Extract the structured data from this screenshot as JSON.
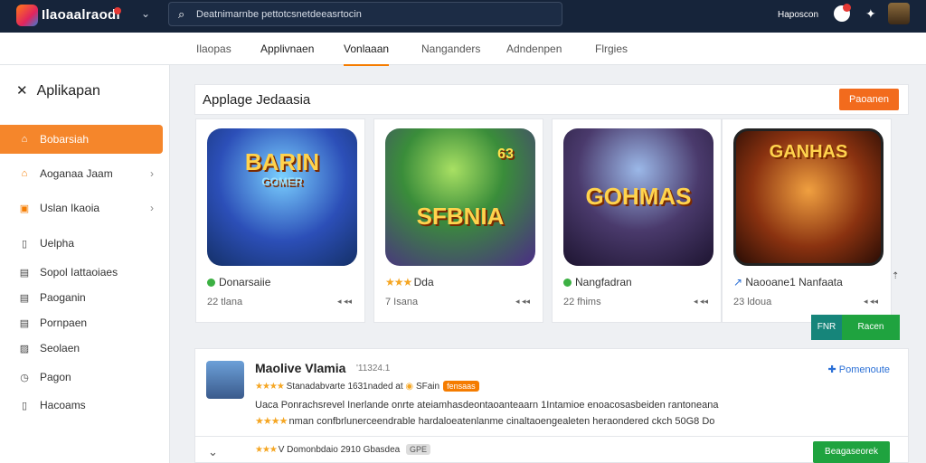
{
  "header": {
    "app_name": "Ilaoaalraodi",
    "search_placeholder": "Deatnimarnbe pettotcsnetdeeasrtocin",
    "user_name": "Haposcon"
  },
  "tabs": [
    {
      "label": "Ilaopas"
    },
    {
      "label": "Applivnaen"
    },
    {
      "label": "Vonlaaan"
    },
    {
      "label": "Nanganders"
    },
    {
      "label": "Adndenpen"
    },
    {
      "label": "Flrgies"
    }
  ],
  "sidebar": {
    "title": "Aplikapan",
    "items": [
      {
        "label": "Bobarsiah",
        "icon": "home-icon"
      },
      {
        "label": "Aoganaa Jaam",
        "icon": "folder-icon"
      },
      {
        "label": "Uslan Ikaoia",
        "icon": "apps-icon"
      },
      {
        "label": "Uelpha",
        "icon": "doc-icon"
      },
      {
        "label": "Sopol Iattaoiaes",
        "icon": "doc-icon"
      },
      {
        "label": "Paoganin",
        "icon": "doc-icon"
      },
      {
        "label": "Pornpaen",
        "icon": "doc-icon"
      },
      {
        "label": "Seolaen",
        "icon": "image-icon"
      },
      {
        "label": "Pagon",
        "icon": "clock-icon"
      },
      {
        "label": "Hacoams",
        "icon": "doc-icon"
      }
    ]
  },
  "section": {
    "title": "Applage Jedaasia",
    "button_label": "Paoanen"
  },
  "games": [
    {
      "art_title": "BARIN",
      "art_sub": "GOMER",
      "name": "Donarsaiie",
      "meta": "22 tlana",
      "status_color": "#3cb043"
    },
    {
      "art_title": "SFBNIA",
      "art_sub": "63",
      "name": "Dda",
      "meta": "7 Isana",
      "status_color": "#f5a623"
    },
    {
      "art_title": "GOHMAS",
      "art_sub": "",
      "name": "Nangfadran",
      "meta": "22 fhims",
      "status_color": "#3cb043"
    },
    {
      "art_title": "GANHAS",
      "art_sub": "",
      "name": "Naooane1 Nanfaata",
      "meta": "23 ldoua",
      "status_color": "#2a6fd6"
    }
  ],
  "buttons": {
    "secondary": "FNR",
    "primary": "Racen"
  },
  "detail": {
    "title": "Maolive Vlamia",
    "subtitle": "'11324.1",
    "rating_text": "Stanadabvarte 1631naded at",
    "badge_text": "SFain",
    "tag": "fensaas",
    "follow_label": "Pomenoute",
    "desc1": "Uaca Ponrachsrevel Inerlande onrte ateiamhasdeontaoanteaarn 1Intamioe enoacosasbeiden rantoneana",
    "desc2": "nman confbrlunerceendrable hardaloeatenlanme cinaltaoengealeten heraondered ckch 50G8 Do",
    "row3_text": "V Domonbdaio 2910 Gbasdea",
    "row3_badge": "GPE",
    "get_label": "Beagaseorek"
  }
}
